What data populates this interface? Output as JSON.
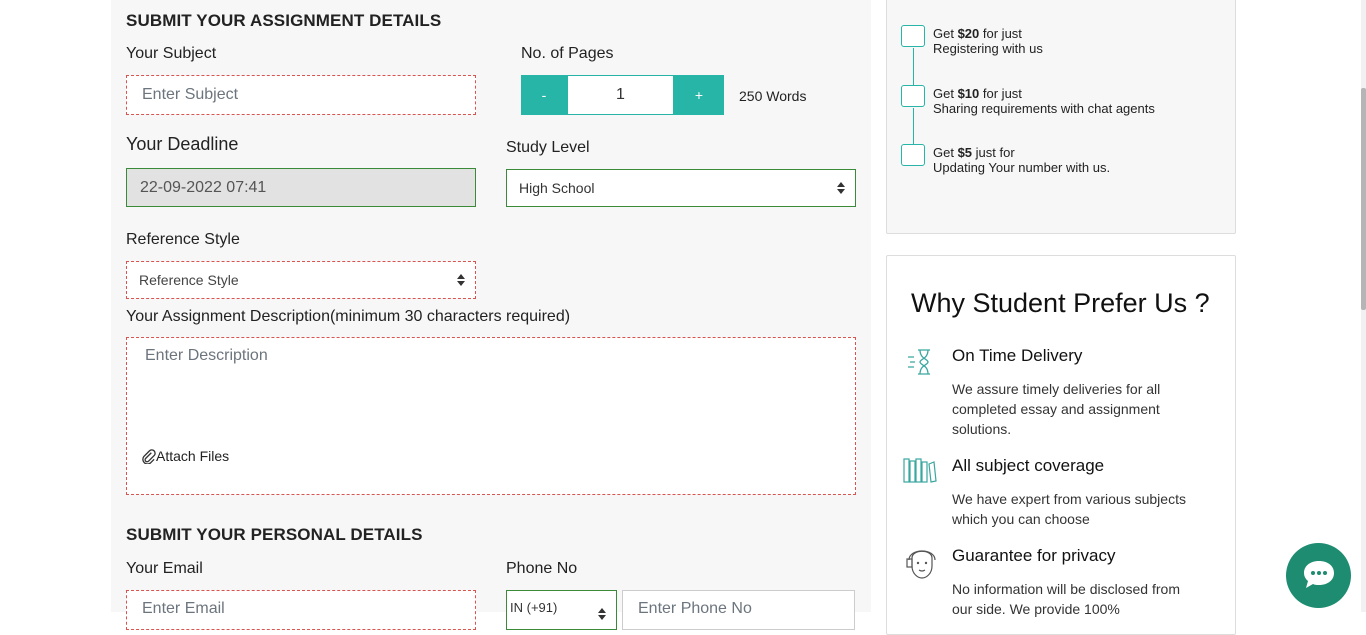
{
  "assignment": {
    "section_title": "SUBMIT YOUR ASSIGNMENT DETAILS",
    "subject_label": "Your Subject",
    "subject_placeholder": "Enter Subject",
    "pages_label": "No. of Pages",
    "minus_label": "-",
    "plus_label": "+",
    "pages_value": "1",
    "words_text": "250 Words",
    "deadline_label": "Your Deadline",
    "deadline_value": "22-09-2022 07:41",
    "study_level_label": "Study Level",
    "study_level_value": "High School",
    "reference_label": "Reference Style",
    "reference_value": "Reference Style",
    "description_label": "Your Assignment Description(minimum 30 characters required)",
    "description_placeholder": "Enter Description",
    "attach_label": "Attach Files"
  },
  "personal": {
    "section_title": "SUBMIT YOUR PERSONAL DETAILS",
    "email_label": "Your Email",
    "email_placeholder": "Enter Email",
    "phone_label": "Phone No",
    "country_code": "IN (+91)",
    "phone_placeholder": "Enter Phone No"
  },
  "offers": [
    {
      "prefix": "Get ",
      "amount": "$20",
      "suffix": " for just",
      "line2": "Registering with us"
    },
    {
      "prefix": "Get ",
      "amount": "$10",
      "suffix": " for just",
      "line2": "Sharing requirements with chat agents"
    },
    {
      "prefix": "Get ",
      "amount": "$5",
      "suffix": " just for",
      "line2": "Updating Your number with us."
    }
  ],
  "why": {
    "title": "Why Student Prefer Us ?",
    "features": [
      {
        "icon": "hourglass-icon",
        "title": "On Time Delivery",
        "desc": "We assure timely deliveries for all completed essay and assignment solutions."
      },
      {
        "icon": "books-icon",
        "title": "All subject coverage",
        "desc": "We have expert from various subjects which you can choose"
      },
      {
        "icon": "privacy-face-icon",
        "title": "Guarantee for privacy",
        "desc": "No information will be disclosed from our side. We provide 100%"
      }
    ]
  },
  "chat": {
    "icon": "chat-bubble-icon"
  },
  "colors": {
    "accent": "#26b5a7",
    "error_border": "#d9534f",
    "valid_border": "#3a8a3a",
    "chat": "#1d8c70"
  }
}
